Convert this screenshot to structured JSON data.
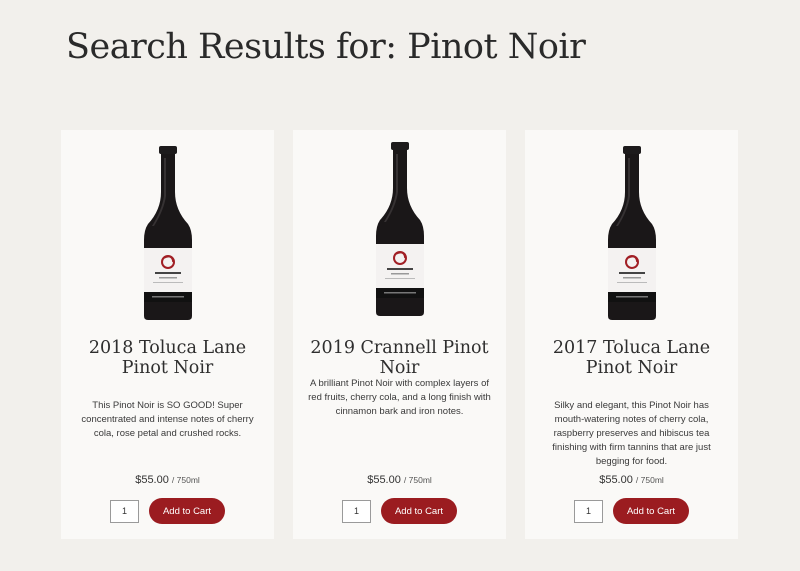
{
  "header": {
    "top_text": "",
    "title": "Search Results for: Pinot Noir"
  },
  "products": [
    {
      "title": "2018 Toluca Lane Pinot Noir",
      "description": "This Pinot Noir is SO GOOD! Super concentrated and intense notes of cherry cola, rose petal and crushed rocks.",
      "price": "$55.00",
      "unit": "/ 750ml",
      "quantity": "1",
      "add_label": "Add to Cart",
      "image_icon": "wine-bottle-icon"
    },
    {
      "title": "2019 Crannell Pinot Noir",
      "description": "A brilliant Pinot Noir with complex layers of red fruits, cherry cola, and a long finish with cinnamon bark and iron notes.",
      "price": "$55.00",
      "unit": "/ 750ml",
      "quantity": "1",
      "add_label": "Add to Cart",
      "image_icon": "wine-bottle-icon"
    },
    {
      "title": "2017 Toluca Lane Pinot Noir",
      "description": "Silky and elegant, this Pinot Noir has mouth-watering notes of cherry cola, raspberry preserves and hibiscus tea finishing with firm tannins that are just begging for food.",
      "price": "$55.00",
      "unit": "/ 750ml",
      "quantity": "1",
      "add_label": "Add to Cart",
      "image_icon": "wine-bottle-icon"
    }
  ],
  "colors": {
    "page_bg": "#f2f0ec",
    "card_bg": "#faf9f7",
    "accent": "#9b1c20"
  }
}
